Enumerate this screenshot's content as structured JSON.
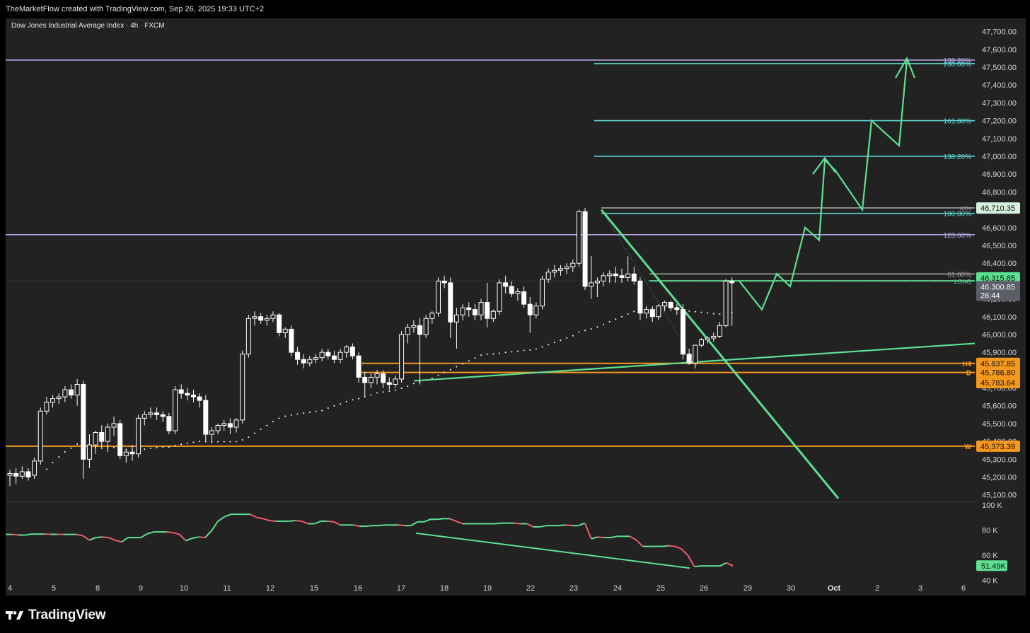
{
  "header": {
    "attribution": "TheMarketFlow created with TradingView.com, Sep 26, 2025 19:33 UTC+2",
    "symbol": "Dow Jones Industrial Average Index · 4h · FXCM"
  },
  "footer": {
    "brand": "TradingView",
    "logo_icon": "tradingview-logo-icon"
  },
  "colors": {
    "background": "#222222",
    "up_candle": "#ffffff",
    "down_candle": "#ffffff",
    "projection": "#5ee092",
    "fib_teal": "#5ed6d6",
    "fib_purple": "#b4a2e0",
    "level_orange": "#f5981e",
    "vol_up": "#5ee092",
    "vol_down": "#f05a6e"
  },
  "chart_data": [
    {
      "type": "candlestick",
      "title": "Dow Jones Industrial Average Index · 4h · FXCM",
      "price_axis": {
        "ticks": [
          "47,700.00",
          "47,600.00",
          "47,500.00",
          "47,400.00",
          "47,300.00",
          "47,200.00",
          "47,100.00",
          "47,000.00",
          "46,900.00",
          "46,800.00",
          "46,700.00",
          "46,600.00",
          "46,500.00",
          "46,400.00",
          "46,300.00",
          "46,200.00",
          "46,100.00",
          "46,000.00",
          "45,900.00",
          "45,800.00",
          "45,700.00",
          "45,600.00",
          "45,500.00",
          "45,400.00",
          "45,300.00",
          "45,200.00",
          "45,100.00"
        ],
        "range": [
          45075,
          47770
        ]
      },
      "time_axis": {
        "ticks": [
          "4",
          "5",
          "8",
          "9",
          "10",
          "11",
          "12",
          "15",
          "16",
          "17",
          "18",
          "19",
          "22",
          "23",
          "24",
          "25",
          "26",
          "29",
          "30",
          "Oct",
          "2",
          "3",
          "6"
        ]
      },
      "candles": [
        [
          45210,
          45240,
          45150,
          45220
        ],
        [
          45220,
          45250,
          45160,
          45205
        ],
        [
          45205,
          45260,
          45190,
          45230
        ],
        [
          45230,
          45250,
          45180,
          45200
        ],
        [
          45210,
          45310,
          45190,
          45290
        ],
        [
          45290,
          45590,
          45270,
          45570
        ],
        [
          45570,
          45650,
          45550,
          45620
        ],
        [
          45620,
          45660,
          45590,
          45640
        ],
        [
          45640,
          45670,
          45610,
          45650
        ],
        [
          45650,
          45710,
          45620,
          45690
        ],
        [
          45690,
          45720,
          45640,
          45660
        ],
        [
          45660,
          45750,
          45600,
          45720
        ],
        [
          45720,
          45740,
          45190,
          45300
        ],
        [
          45300,
          45440,
          45250,
          45380
        ],
        [
          45380,
          45460,
          45330,
          45450
        ],
        [
          45450,
          45490,
          45360,
          45400
        ],
        [
          45400,
          45500,
          45340,
          45480
        ],
        [
          45480,
          45540,
          45430,
          45500
        ],
        [
          45500,
          45520,
          45300,
          45320
        ],
        [
          45320,
          45360,
          45280,
          45340
        ],
        [
          45340,
          45380,
          45290,
          45330
        ],
        [
          45330,
          45550,
          45310,
          45530
        ],
        [
          45530,
          45570,
          45490,
          45550
        ],
        [
          45550,
          45590,
          45530,
          45560
        ],
        [
          45560,
          45590,
          45520,
          45550
        ],
        [
          45550,
          45570,
          45510,
          45540
        ],
        [
          45540,
          45560,
          45440,
          45460
        ],
        [
          45460,
          45710,
          45440,
          45690
        ],
        [
          45690,
          45720,
          45640,
          45670
        ],
        [
          45670,
          45700,
          45630,
          45660
        ],
        [
          45660,
          45690,
          45620,
          45650
        ],
        [
          45650,
          45670,
          45590,
          45630
        ],
        [
          45630,
          45660,
          45400,
          45440
        ],
        [
          45440,
          45480,
          45390,
          45460
        ],
        [
          45460,
          45500,
          45440,
          45490
        ],
        [
          45490,
          45520,
          45460,
          45500
        ],
        [
          45500,
          45530,
          45440,
          45480
        ],
        [
          45480,
          45530,
          45450,
          45520
        ],
        [
          45520,
          45910,
          45500,
          45890
        ],
        [
          45890,
          46110,
          45870,
          46090
        ],
        [
          46090,
          46130,
          46050,
          46100
        ],
        [
          46100,
          46120,
          46060,
          46080
        ],
        [
          46080,
          46110,
          46050,
          46090
        ],
        [
          46090,
          46130,
          46070,
          46110
        ],
        [
          46110,
          46120,
          45990,
          46010
        ],
        [
          46010,
          46040,
          45980,
          46030
        ],
        [
          46030,
          46050,
          45880,
          45900
        ],
        [
          45900,
          45930,
          45830,
          45860
        ],
        [
          45860,
          45890,
          45810,
          45840
        ],
        [
          45840,
          45880,
          45820,
          45860
        ],
        [
          45860,
          45890,
          45840,
          45870
        ],
        [
          45870,
          45920,
          45850,
          45900
        ],
        [
          45900,
          45920,
          45860,
          45880
        ],
        [
          45880,
          45910,
          45840,
          45860
        ],
        [
          45860,
          45920,
          45840,
          45900
        ],
        [
          45900,
          45940,
          45870,
          45930
        ],
        [
          45930,
          45950,
          45860,
          45880
        ],
        [
          45880,
          45900,
          45730,
          45760
        ],
        [
          45760,
          45790,
          45650,
          45730
        ],
        [
          45730,
          45780,
          45700,
          45760
        ],
        [
          45760,
          45800,
          45720,
          45780
        ],
        [
          45780,
          45800,
          45700,
          45730
        ],
        [
          45730,
          45760,
          45690,
          45720
        ],
        [
          45720,
          45770,
          45700,
          45750
        ],
        [
          45750,
          46020,
          45730,
          46000
        ],
        [
          46000,
          46060,
          45950,
          46040
        ],
        [
          46040,
          46080,
          46010,
          46050
        ],
        [
          46050,
          46090,
          45720,
          46000
        ],
        [
          46000,
          46110,
          45980,
          46090
        ],
        [
          46090,
          46130,
          46060,
          46120
        ],
        [
          46120,
          46320,
          46100,
          46300
        ],
        [
          46300,
          46330,
          46260,
          46290
        ],
        [
          46290,
          46320,
          45980,
          46070
        ],
        [
          46070,
          46150,
          45920,
          46110
        ],
        [
          46110,
          46170,
          46080,
          46150
        ],
        [
          46150,
          46180,
          46100,
          46140
        ],
        [
          46140,
          46170,
          46080,
          46110
        ],
        [
          46110,
          46200,
          46080,
          46180
        ],
        [
          46180,
          46290,
          46040,
          46090
        ],
        [
          46090,
          46140,
          46070,
          46130
        ],
        [
          46130,
          46310,
          46110,
          46290
        ],
        [
          46290,
          46330,
          46230,
          46270
        ],
        [
          46270,
          46300,
          46210,
          46230
        ],
        [
          46230,
          46260,
          46190,
          46240
        ],
        [
          46240,
          46270,
          46150,
          46170
        ],
        [
          46170,
          46210,
          46010,
          46110
        ],
        [
          46110,
          46180,
          46090,
          46160
        ],
        [
          46160,
          46330,
          46140,
          46310
        ],
        [
          46310,
          46370,
          46290,
          46350
        ],
        [
          46350,
          46390,
          46320,
          46360
        ],
        [
          46360,
          46390,
          46330,
          46370
        ],
        [
          46370,
          46400,
          46340,
          46380
        ],
        [
          46380,
          46420,
          46350,
          46400
        ],
        [
          46400,
          46700,
          46380,
          46690
        ],
        [
          46690,
          46710,
          46250,
          46270
        ],
        [
          46270,
          46440,
          46200,
          46290
        ],
        [
          46290,
          46320,
          46210,
          46300
        ],
        [
          46300,
          46350,
          46270,
          46330
        ],
        [
          46330,
          46360,
          46290,
          46340
        ],
        [
          46340,
          46380,
          46290,
          46330
        ],
        [
          46330,
          46370,
          46290,
          46320
        ],
        [
          46320,
          46440,
          46300,
          46340
        ],
        [
          46340,
          46380,
          46280,
          46300
        ],
        [
          46300,
          46320,
          46080,
          46120
        ],
        [
          46120,
          46160,
          46090,
          46140
        ],
        [
          46140,
          46160,
          46070,
          46100
        ],
        [
          46100,
          46170,
          46080,
          46160
        ],
        [
          46160,
          46190,
          46130,
          46180
        ],
        [
          46180,
          46190,
          46130,
          46150
        ],
        [
          46150,
          46170,
          46110,
          46140
        ],
        [
          46140,
          46170,
          45860,
          45890
        ],
        [
          45890,
          45920,
          45830,
          45840
        ],
        [
          45840,
          45940,
          45810,
          45940
        ],
        [
          45940,
          45980,
          45930,
          45970
        ],
        [
          45970,
          45990,
          45950,
          45980
        ],
        [
          45980,
          46010,
          45960,
          45990
        ],
        [
          45990,
          46070,
          45980,
          46050
        ],
        [
          46050,
          46310,
          46040,
          46300
        ],
        [
          46300,
          46320,
          46050,
          46290
        ]
      ],
      "levels": [
        {
          "label": "138.20%",
          "price": 47540,
          "color": "#b4a2e0"
        },
        {
          "label": "200.00%",
          "price": 47520,
          "color": "#5ed6d6"
        },
        {
          "label": "161.80%",
          "price": 47200,
          "color": "#5ed6d6"
        },
        {
          "label": "138.20%",
          "price": 47000,
          "color": "#5ed6d6"
        },
        {
          "label": "ATH",
          "price": 46710.35,
          "color": "#9e9e9e"
        },
        {
          "label": "100.00%",
          "price": 46680,
          "color": "#5ed6d6"
        },
        {
          "label": "123.60%",
          "price": 46560,
          "color": "#b4a2e0"
        },
        {
          "label": "61.80%",
          "price": 46340,
          "color": "#9e9e9e"
        },
        {
          "label": "LONG",
          "price": 46300.85,
          "color": "#5ee092"
        },
        {
          "label": "H4",
          "price": 45837.85,
          "color": "#f5981e"
        },
        {
          "label": "D",
          "price": 45786.8,
          "color": "#f5981e"
        },
        {
          "label": "W",
          "price": 45373.39,
          "color": "#f5981e"
        }
      ],
      "price_labels": [
        {
          "text": "46,710.35",
          "bg": "#d7f0dc",
          "fg": "#111111"
        },
        {
          "text": "46,315.85",
          "bg": "#5ee092",
          "fg": "#111111"
        },
        {
          "text": "46,300.85",
          "bg": "#5b5e66",
          "fg": "#ffffff"
        },
        {
          "text": "26:44",
          "bg": "#5b5e66",
          "fg": "#ffffff"
        },
        {
          "text": "45,837.85",
          "bg": "#f5981e",
          "fg": "#111111"
        },
        {
          "text": "45,786.80",
          "bg": "#f5981e",
          "fg": "#111111"
        },
        {
          "text": "45,783.64",
          "bg": "#f5981e",
          "fg": "#111111"
        },
        {
          "text": "45,373.39",
          "bg": "#f5981e",
          "fg": "#111111"
        }
      ],
      "projection_path": [
        [
          46300,
          46200
        ],
        [
          46340,
          46150
        ],
        [
          46480,
          46340
        ],
        [
          46420,
          46600
        ],
        [
          46960,
          46980
        ],
        [
          46640,
          46910
        ],
        [
          46340,
          47200
        ],
        [
          47060,
          47180
        ],
        [
          47250,
          47620
        ]
      ],
      "trendlines": [
        {
          "name": "descending-trendline",
          "from": [
            46700,
            "t95"
          ],
          "to": [
            45080,
            "t-proj"
          ]
        },
        {
          "name": "ascending-trendline",
          "from": [
            45740,
            "t60"
          ],
          "to": [
            45950,
            "t-right"
          ]
        }
      ]
    },
    {
      "type": "line",
      "title": "",
      "y_ticks": [
        "100 K",
        "80 K",
        "60 K",
        "40 K"
      ],
      "range": [
        37000,
        101000
      ],
      "last_value_label": "51.49K",
      "values": [
        76500,
        76500,
        76000,
        76000,
        76800,
        76800,
        76800,
        76600,
        76600,
        76500,
        76500,
        76500,
        75500,
        72000,
        74000,
        74500,
        74000,
        72000,
        70500,
        74000,
        74000,
        74000,
        77000,
        78500,
        78500,
        78500,
        78000,
        76500,
        71500,
        73500,
        74500,
        74000,
        79500,
        87000,
        90500,
        92500,
        92500,
        92500,
        92500,
        90000,
        89000,
        87500,
        87000,
        87000,
        87000,
        87500,
        87000,
        85000,
        85000,
        87000,
        87000,
        86500,
        84000,
        84000,
        84000,
        83000,
        83000,
        83500,
        83500,
        84000,
        84000,
        84000,
        83500,
        83500,
        86500,
        86500,
        88500,
        88500,
        89000,
        89000,
        87000,
        85000,
        85000,
        85000,
        85000,
        85000,
        85000,
        85500,
        85500,
        85500,
        85000,
        85000,
        82500,
        82500,
        83500,
        83500,
        83500,
        84000,
        83500,
        83500,
        85500,
        73000,
        74500,
        74000,
        74000,
        75000,
        75000,
        75000,
        72000,
        67000,
        67000,
        67000,
        67000,
        67500,
        67000,
        65000,
        60000,
        51000,
        51500,
        51500,
        51500,
        51500,
        54000,
        51490
      ],
      "trendline": {
        "from": [
          77500,
          "t83"
        ],
        "to": [
          49800,
          "t-near"
        ]
      }
    }
  ]
}
